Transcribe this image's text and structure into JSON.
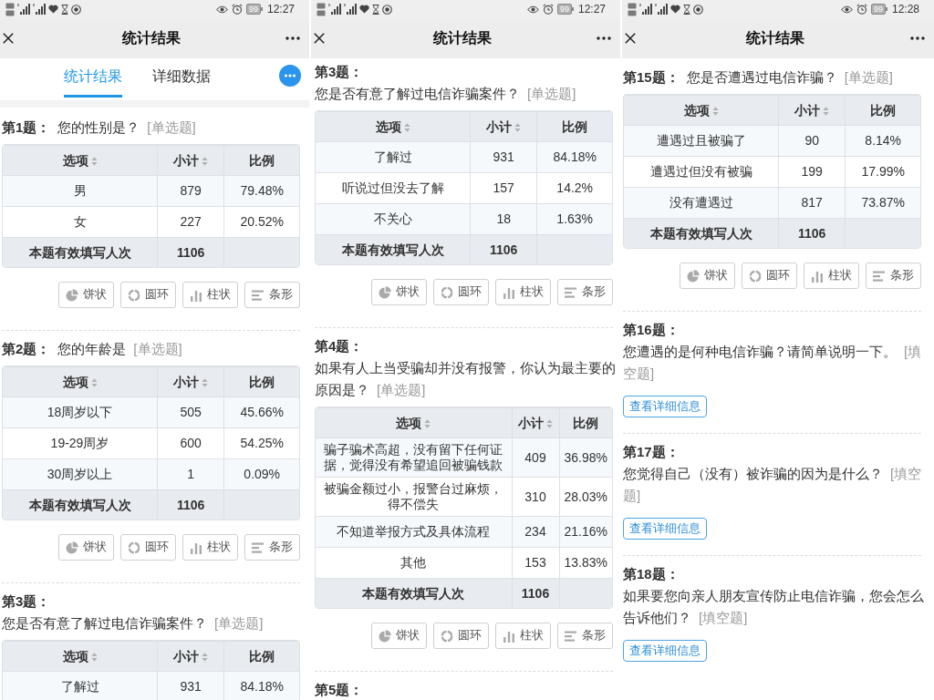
{
  "screens": [
    {
      "status_bar": {
        "battery": "99",
        "time": "12:27"
      },
      "nav": {
        "title": "统计结果"
      },
      "tabs": [
        {
          "label": "统计结果",
          "selected": true
        },
        {
          "label": "详细数据",
          "selected": false
        }
      ],
      "questions": [
        {
          "kind": "choice",
          "number": "第1题：",
          "text": "您的性别是？",
          "type": "[单选题]",
          "columns": [
            {
              "label": "选项",
              "sortable": true
            },
            {
              "label": "小计",
              "sortable": true
            },
            {
              "label": "比例",
              "sortable": false
            }
          ],
          "rows": [
            [
              "男",
              "879",
              "79.48%"
            ],
            [
              "女",
              "227",
              "20.52%"
            ]
          ],
          "total": {
            "label": "本题有效填写人次",
            "count": "1106"
          },
          "chart_buttons": [
            {
              "label": "饼状",
              "kind": "pie"
            },
            {
              "label": "圆环",
              "kind": "donut"
            },
            {
              "label": "柱状",
              "kind": "bar"
            },
            {
              "label": "条形",
              "kind": "hbar"
            }
          ]
        },
        {
          "kind": "choice",
          "number": "第2题：",
          "text": "您的年龄是",
          "type": "[单选题]",
          "columns": [
            {
              "label": "选项",
              "sortable": true
            },
            {
              "label": "小计",
              "sortable": true
            },
            {
              "label": "比例",
              "sortable": false
            }
          ],
          "rows": [
            [
              "18周岁以下",
              "505",
              "45.66%"
            ],
            [
              "19-29周岁",
              "600",
              "54.25%"
            ],
            [
              "30周岁以上",
              "1",
              "0.09%"
            ]
          ],
          "total": {
            "label": "本题有效填写人次",
            "count": "1106"
          },
          "chart_buttons": [
            {
              "label": "饼状",
              "kind": "pie"
            },
            {
              "label": "圆环",
              "kind": "donut"
            },
            {
              "label": "柱状",
              "kind": "bar"
            },
            {
              "label": "条形",
              "kind": "hbar"
            }
          ]
        },
        {
          "kind": "choice",
          "number": "第3题：",
          "text": "您是否有意了解过电信诈骗案件？",
          "type": "[单选题]",
          "columns": [
            {
              "label": "选项",
              "sortable": true
            },
            {
              "label": "小计",
              "sortable": true
            },
            {
              "label": "比例",
              "sortable": false
            }
          ],
          "rows": [
            [
              "了解过",
              "931",
              "84.18%"
            ]
          ]
        }
      ]
    },
    {
      "status_bar": {
        "battery": "99",
        "time": "12:27"
      },
      "nav": {
        "title": "统计结果"
      },
      "questions": [
        {
          "kind": "choice",
          "number": "第3题：",
          "text": "您是否有意了解过电信诈骗案件？",
          "type": "[单选题]",
          "columns": [
            {
              "label": "选项",
              "sortable": true
            },
            {
              "label": "小计",
              "sortable": true
            },
            {
              "label": "比例",
              "sortable": false
            }
          ],
          "rows": [
            [
              "了解过",
              "931",
              "84.18%"
            ],
            [
              "听说过但没去了解",
              "157",
              "14.2%"
            ],
            [
              "不关心",
              "18",
              "1.63%"
            ]
          ],
          "total": {
            "label": "本题有效填写人次",
            "count": "1106"
          },
          "chart_buttons": [
            {
              "label": "饼状",
              "kind": "pie"
            },
            {
              "label": "圆环",
              "kind": "donut"
            },
            {
              "label": "柱状",
              "kind": "bar"
            },
            {
              "label": "条形",
              "kind": "hbar"
            }
          ]
        },
        {
          "kind": "choice",
          "number": "第4题：",
          "text": "如果有人上当受骗却并没有报警，你认为最主要的原因是？",
          "type": "[单选题]",
          "columns": [
            {
              "label": "选项",
              "sortable": true
            },
            {
              "label": "小计",
              "sortable": true
            },
            {
              "label": "比例",
              "sortable": false
            }
          ],
          "rows": [
            [
              "骗子骗术高超，没有留下任何证据，觉得没有希望追回被骗钱款",
              "409",
              "36.98%"
            ],
            [
              "被骗金额过小，报警台过麻烦，得不偿失",
              "310",
              "28.03%"
            ],
            [
              "不知道举报方式及具体流程",
              "234",
              "21.16%"
            ],
            [
              "其他",
              "153",
              "13.83%"
            ]
          ],
          "total": {
            "label": "本题有效填写人次",
            "count": "1106"
          },
          "chart_buttons": [
            {
              "label": "饼状",
              "kind": "pie"
            },
            {
              "label": "圆环",
              "kind": "donut"
            },
            {
              "label": "柱状",
              "kind": "bar"
            },
            {
              "label": "条形",
              "kind": "hbar"
            }
          ]
        },
        {
          "number": "第5题："
        }
      ]
    },
    {
      "status_bar": {
        "battery": "99",
        "time": "12:28"
      },
      "nav": {
        "title": "统计结果"
      },
      "questions": [
        {
          "kind": "choice",
          "number": "第15题：",
          "text": "您是否遭遇过电信诈骗？",
          "type": "[单选题]",
          "columns": [
            {
              "label": "选项",
              "sortable": true
            },
            {
              "label": "小计",
              "sortable": true
            },
            {
              "label": "比例",
              "sortable": false
            }
          ],
          "rows": [
            [
              "遭遇过且被骗了",
              "90",
              "8.14%"
            ],
            [
              "遭遇过但没有被骗",
              "199",
              "17.99%"
            ],
            [
              "没有遭遇过",
              "817",
              "73.87%"
            ]
          ],
          "total": {
            "label": "本题有效填写人次",
            "count": "1106"
          },
          "chart_buttons": [
            {
              "label": "饼状",
              "kind": "pie"
            },
            {
              "label": "圆环",
              "kind": "donut"
            },
            {
              "label": "柱状",
              "kind": "bar"
            },
            {
              "label": "条形",
              "kind": "hbar"
            }
          ]
        },
        {
          "kind": "fill",
          "number": "第16题：",
          "text": "您遭遇的是何种电信诈骗？请简单说明一下。",
          "type": "[填空题]",
          "detail_button": "查看详细信息"
        },
        {
          "kind": "fill",
          "number": "第17题：",
          "text": "您觉得自己（没有）被诈骗的因为是什么？",
          "type": "[填空题]",
          "detail_button": "查看详细信息"
        },
        {
          "kind": "fill",
          "number": "第18题：",
          "text": "如果要您向亲人朋友宣传防止电信诈骗，您会怎么告诉他们？",
          "type": "[填空题]",
          "detail_button": "查看详细信息"
        }
      ]
    }
  ]
}
